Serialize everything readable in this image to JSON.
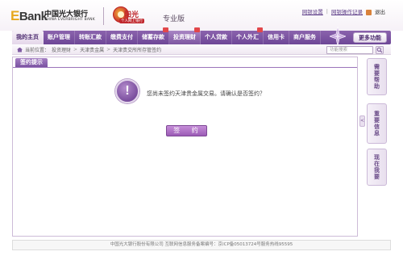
{
  "header": {
    "ebank_logo": "Bank",
    "ebank_logo_e": "E",
    "bank_name_cn": "中国光大银行",
    "bank_name_en": "CHINA EVERBRIGHT BANK",
    "sunshine_name": "阳光",
    "sunshine_tag": "个人网上银行",
    "edition": "专业版",
    "links": {
      "settings": "网银设置",
      "operation_log": "网银操作记录",
      "exit": "退出"
    }
  },
  "nav": {
    "items": [
      {
        "label": "我的主页",
        "active": true
      },
      {
        "label": "账户管理"
      },
      {
        "label": "转账汇款"
      },
      {
        "label": "缴费支付"
      },
      {
        "label": "储蓄存款"
      },
      {
        "label": "投资理财",
        "highlight": true
      },
      {
        "label": "个人贷款"
      },
      {
        "label": "个人外汇"
      },
      {
        "label": "信用卡"
      },
      {
        "label": "商户服务"
      }
    ],
    "more_label": "更多功能"
  },
  "breadcrumb": {
    "prefix": "当前位置：",
    "items": [
      "投资理财",
      "天津贵金属",
      "天津贵交所所存管签约"
    ]
  },
  "search": {
    "placeholder": "功能搜索"
  },
  "panel": {
    "tab_label": "签约提示",
    "alert_symbol": "!",
    "message": "您尚未签约天津贵金属交易。请确认是否签约？",
    "sign_button": "签 约"
  },
  "sidebar": {
    "collapse_symbol": "<",
    "buttons": [
      "需要帮助",
      "重要信息",
      "现在我要"
    ]
  },
  "footer": {
    "text": "中国光大银行股份有限公司 互联网信息服务备案编号：京ICP备05013724号服务热线95595"
  },
  "colors": {
    "brand_purple": "#6e4797",
    "accent_red": "#c0272d",
    "ebank_gold": "#e7a81d"
  }
}
